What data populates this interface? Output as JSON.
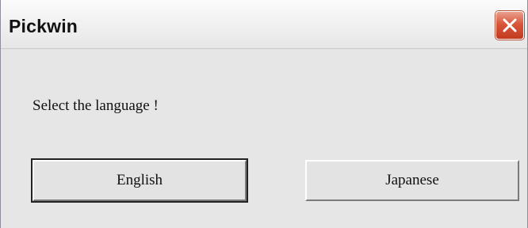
{
  "window": {
    "title": "Pickwin"
  },
  "dialog": {
    "prompt": "Select the language !",
    "buttons": {
      "english_label": "English",
      "japanese_label": "Japanese"
    }
  },
  "icons": {
    "close": "close-icon"
  },
  "colors": {
    "close_button": "#d9563a",
    "dialog_background": "#e6e6e6"
  }
}
